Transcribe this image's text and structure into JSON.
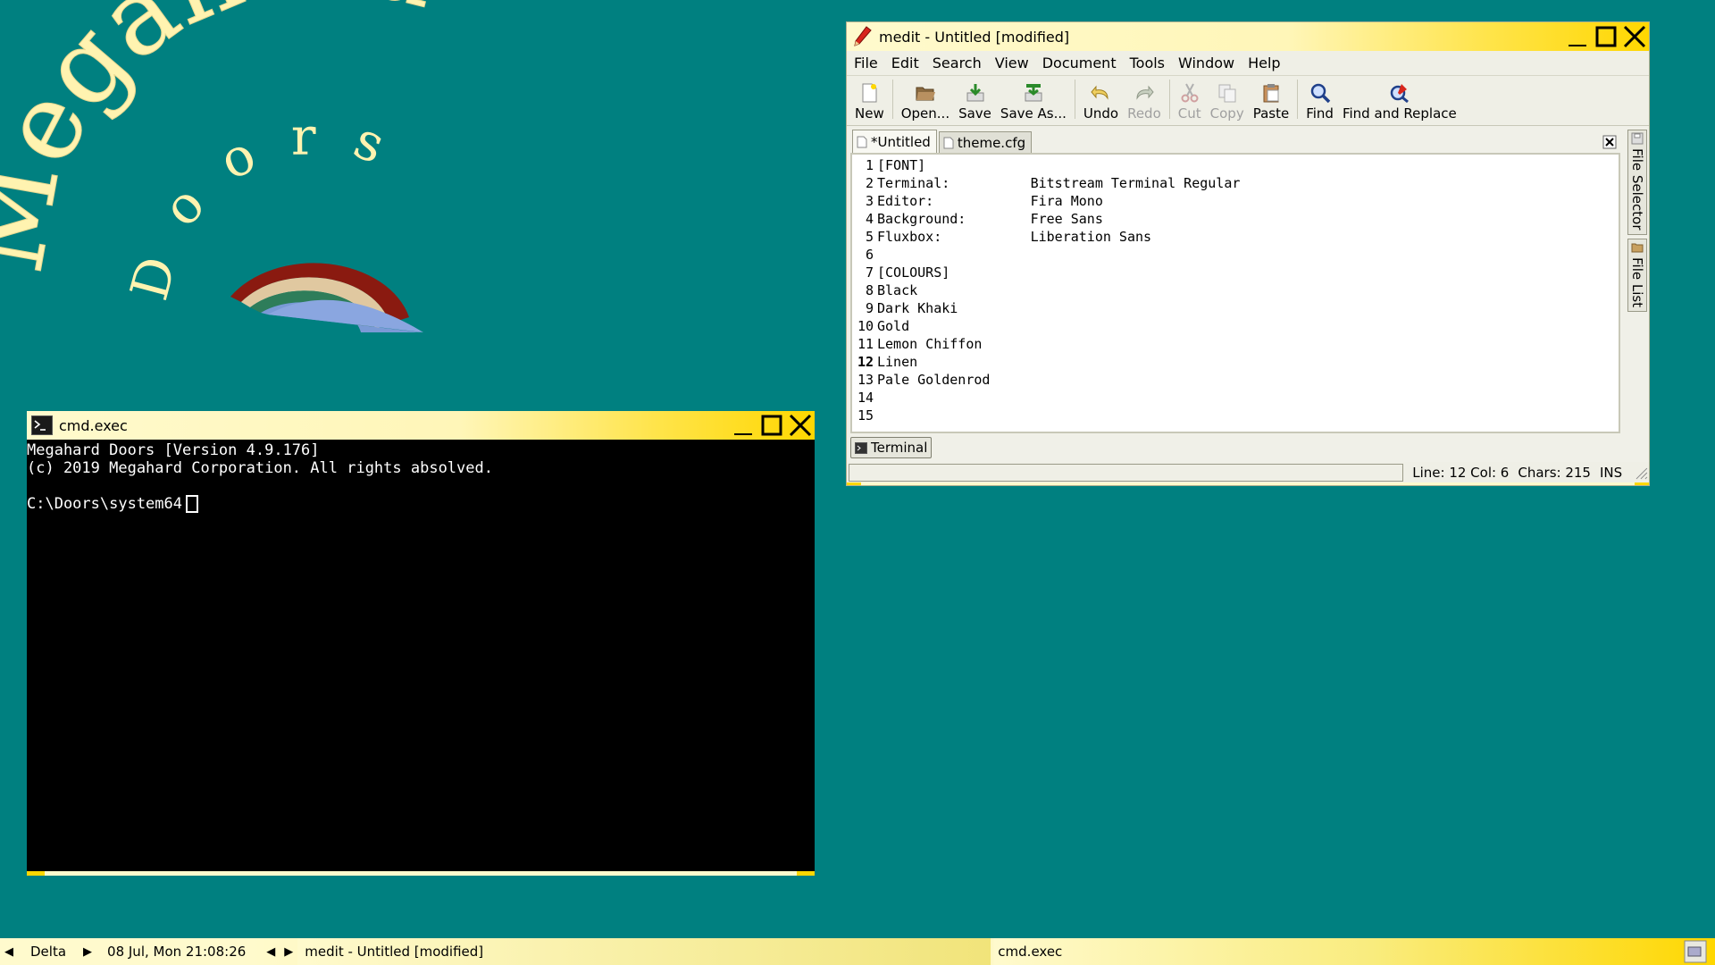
{
  "logo": {
    "word_top": "Megahard",
    "word_bottom": "Doors",
    "colors": {
      "text": "#fff3b0",
      "text_alt": "#ffd700"
    }
  },
  "terminal_window": {
    "title": "cmd.exec",
    "lines": [
      "Megahard Doors [Version 4.9.176]",
      "(c) 2019 Megahard Corporation. All rights absolved.",
      "",
      "C:\\Doors\\system64"
    ]
  },
  "medit_window": {
    "title": "medit - Untitled [modified]",
    "menu": [
      "File",
      "Edit",
      "Search",
      "View",
      "Document",
      "Tools",
      "Window",
      "Help"
    ],
    "toolbar": {
      "new": "New",
      "open": "Open...",
      "save": "Save",
      "save_as": "Save As...",
      "undo": "Undo",
      "redo": "Redo",
      "cut": "Cut",
      "copy": "Copy",
      "paste": "Paste",
      "find": "Find",
      "find_replace": "Find and Replace"
    },
    "tabs": [
      "*Untitled",
      "theme.cfg"
    ],
    "line_numbers": [
      "1",
      "2",
      "3",
      "4",
      "5",
      "6",
      "7",
      "8",
      "9",
      "10",
      "11",
      "12",
      "13",
      "14",
      "15"
    ],
    "current_line": 12,
    "lines": [
      "[FONT]",
      "Terminal:          Bitstream Terminal Regular",
      "Editor:            Fira Mono",
      "Background:        Free Sans",
      "Fluxbox:           Liberation Sans",
      "",
      "[COLOURS]",
      "Black",
      "Dark Khaki",
      "Gold",
      "Lemon Chiffon",
      "Linen",
      "Pale Goldenrod",
      "",
      ""
    ],
    "bottom_tab": "Terminal",
    "side_tabs": [
      "File Selector",
      "File List"
    ],
    "status": {
      "position": "Line: 12 Col: 6",
      "chars": "Chars: 215",
      "mode": "INS"
    }
  },
  "taskbar": {
    "workspace": "Delta",
    "clock": "08 Jul, Mon 21:08:26",
    "tasks": [
      "medit - Untitled [modified]",
      "cmd.exec"
    ]
  }
}
